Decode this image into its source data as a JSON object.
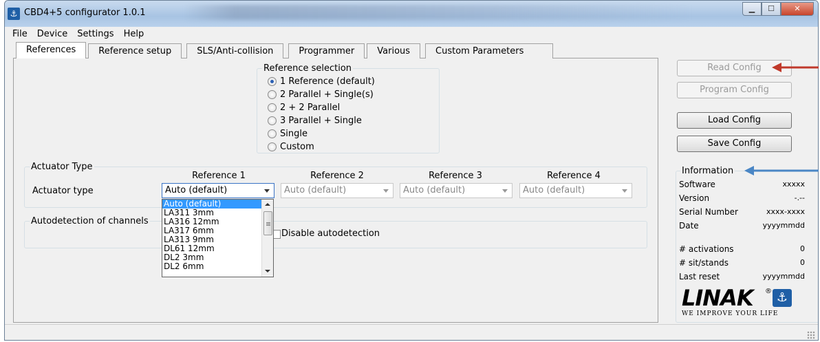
{
  "window": {
    "title": "CBD4+5 configurator 1.0.1",
    "controls": {
      "minimize": "▁",
      "maximize": "☐",
      "close": "✕"
    }
  },
  "menu": [
    "File",
    "Device",
    "Settings",
    "Help"
  ],
  "tabs": [
    "References",
    "Reference setup",
    "SLS/Anti-collision",
    "Programmer",
    "Various",
    "Custom Parameters"
  ],
  "reference_selection": {
    "legend": "Reference selection",
    "options": [
      "1 Reference (default)",
      "2 Parallel + Single(s)",
      "2 + 2 Parallel",
      "3 Parallel + Single",
      "Single",
      "Custom"
    ],
    "selected": "1 Reference (default)"
  },
  "actuator_type": {
    "legend": "Actuator Type",
    "row_label": "Actuator type",
    "columns": [
      "Reference 1",
      "Reference 2",
      "Reference 3",
      "Reference 4"
    ],
    "values": [
      "Auto (default)",
      "Auto (default)",
      "Auto (default)",
      "Auto (default)"
    ]
  },
  "dropdown": {
    "items": [
      "Auto (default)",
      "LA311 3mm",
      "LA316 12mm",
      "LA317 6mm",
      "LA313 9mm",
      "DL61 12mm",
      "DL2 3mm",
      "DL2 6mm"
    ],
    "selected": "Auto (default)"
  },
  "autodetection": {
    "legend": "Autodetection of channels",
    "checkbox_label": "Disable autodetection",
    "checked": false
  },
  "buttons": {
    "read_config": "Read Config",
    "program_config": "Program Config",
    "load_config": "Load Config",
    "save_config": "Save Config"
  },
  "information": {
    "legend": "Information",
    "rows": [
      {
        "label": "Software",
        "value": "xxxxx"
      },
      {
        "label": "Version",
        "value": "-.--"
      },
      {
        "label": "Serial Number",
        "value": "xxxx-xxxx"
      },
      {
        "label": "Date",
        "value": "yyyymmdd"
      },
      {
        "label": "# activations",
        "value": "0"
      },
      {
        "label": "# sit/stands",
        "value": "0"
      },
      {
        "label": "Last reset",
        "value": "yyyymmdd"
      }
    ]
  },
  "logo": {
    "wordmark": "LINAK",
    "registered": "®",
    "tagline": "WE IMPROVE YOUR LIFE"
  },
  "colors": {
    "annotation_red": "#c0392b",
    "annotation_blue": "#4a86c5",
    "selection_blue": "#3399ff",
    "linak_blue": "#1f5fa6"
  }
}
